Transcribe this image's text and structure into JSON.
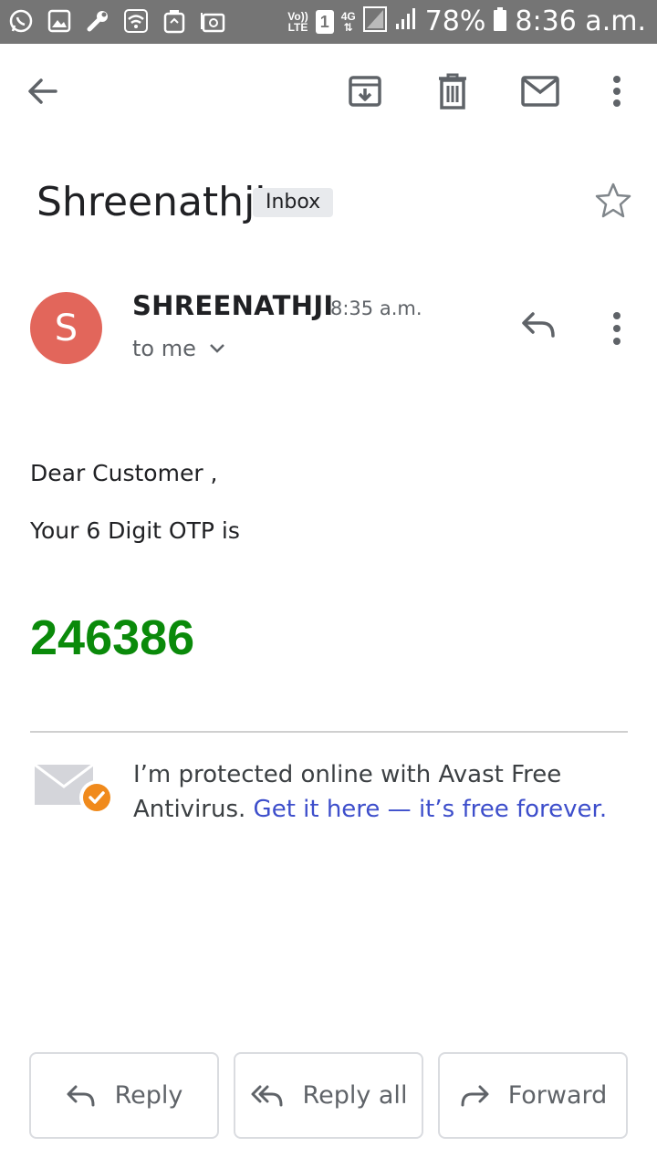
{
  "status_bar": {
    "network_top": "Vo))",
    "network_bottom": "LTE",
    "sim": "1",
    "data_type": "4G",
    "battery": "78%",
    "time": "8:36 a.m."
  },
  "toolbar": {
    "icons": [
      "back-arrow-icon",
      "archive-icon",
      "delete-icon",
      "mark-unread-icon",
      "more-vert-icon"
    ]
  },
  "email": {
    "subject": "Shreenathji",
    "label": "Inbox",
    "sender": {
      "initial": "S",
      "name": "SHREENATHJI",
      "time": "8:35 a.m.",
      "recipient": "to me",
      "avatar_color": "#e2665b"
    },
    "body": {
      "greeting": "Dear Customer ,",
      "line": "Your 6 Digit OTP is",
      "otp": "246386",
      "otp_color": "#0a8a0a"
    },
    "signature": {
      "text": "I’m protected online with Avast Free Antivirus.",
      "link": "Get it here — it’s free forever."
    }
  },
  "actions": {
    "reply": "Reply",
    "reply_all": "Reply all",
    "forward": "Forward"
  },
  "colors": {
    "status_bar": "#757575",
    "link": "#3d4ecb"
  }
}
